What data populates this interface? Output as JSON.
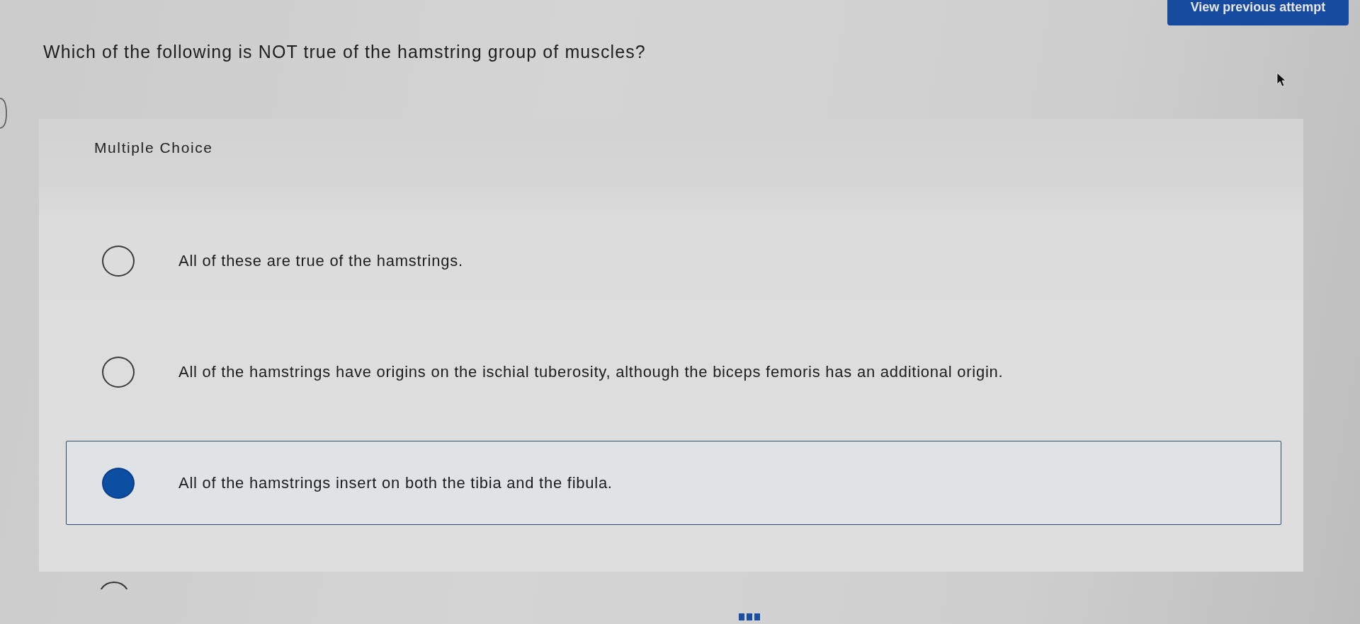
{
  "header": {
    "button": "View previous attempt"
  },
  "question": {
    "text": "Which of the following is NOT true of the hamstring group of muscles?"
  },
  "answer_panel": {
    "type_label": "Multiple Choice",
    "options": [
      {
        "text": "All of these are true of the hamstrings.",
        "selected": false
      },
      {
        "text": "All of the hamstrings have origins on the ischial tuberosity, although the biceps femoris has an additional origin.",
        "selected": false
      },
      {
        "text": "All of the hamstrings insert on both the tibia and the fibula.",
        "selected": true
      },
      {
        "selected": false
      }
    ]
  }
}
